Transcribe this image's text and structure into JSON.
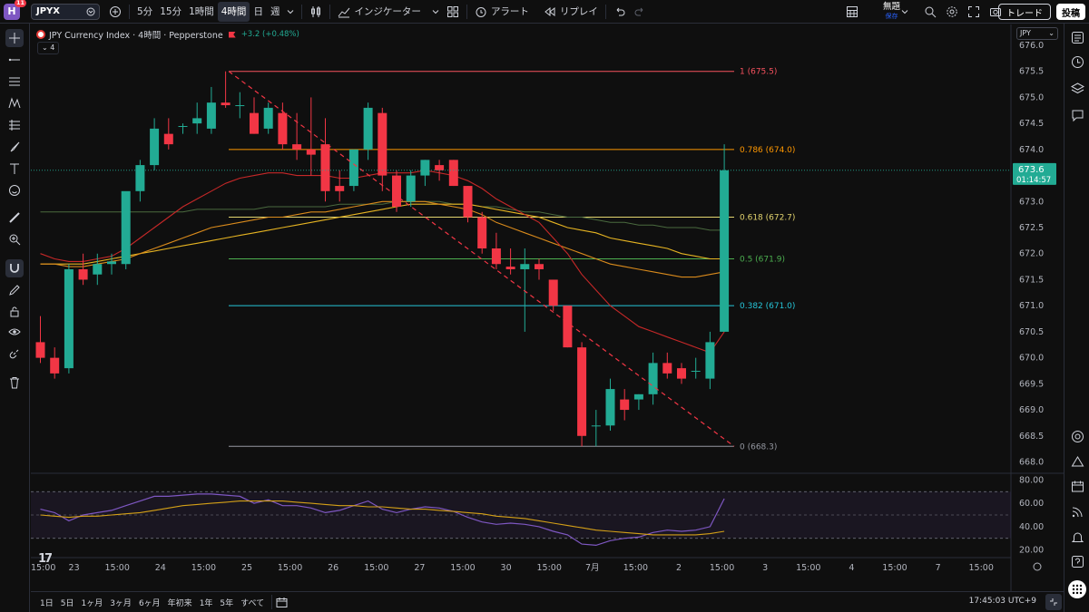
{
  "topbar": {
    "logo_letter": "H",
    "notification_count": "11",
    "symbol": "JPYX",
    "intervals": [
      "5分",
      "15分",
      "1時間",
      "4時間",
      "日",
      "週"
    ],
    "active_interval_index": 3,
    "indicators_label": "インジケーター",
    "alert_label": "アラート",
    "replay_label": "リプレイ",
    "layout_name": "無題",
    "layout_status": "保存",
    "trade_label": "トレード",
    "publish_label": "投稿"
  },
  "legend": {
    "title": "JPY Currency Index · 4時間 · Pepperstone",
    "change": "+3.2 (+0.48%)",
    "indicator_count": "4"
  },
  "currency_select": "JPY",
  "price_axis": {
    "labels": [
      "676.0",
      "675.5",
      "675.0",
      "674.5",
      "674.0",
      "673.0",
      "672.5",
      "672.0",
      "671.5",
      "671.0",
      "670.5",
      "670.0",
      "669.5",
      "669.0",
      "668.5",
      "668.0"
    ],
    "current_price": "673.6",
    "countdown": "01:14:57"
  },
  "rsi_axis": {
    "labels": [
      "80.00",
      "60.00",
      "40.00",
      "20.00"
    ]
  },
  "time_axis": {
    "labels": [
      "15:00",
      "23",
      "15:00",
      "24",
      "15:00",
      "25",
      "15:00",
      "26",
      "15:00",
      "27",
      "15:00",
      "30",
      "15:00",
      "7月",
      "15:00",
      "2",
      "15:00",
      "3",
      "15:00",
      "4",
      "15:00",
      "7",
      "15:00"
    ]
  },
  "fib_levels": [
    {
      "ratio": "1",
      "value": 675.5,
      "label": "1 (675.5)",
      "color": "#f7525f"
    },
    {
      "ratio": "0.786",
      "value": 674.0,
      "label": "0.786 (674.0)",
      "color": "#ff9800"
    },
    {
      "ratio": "0.618",
      "value": 672.7,
      "label": "0.618 (672.7)",
      "color": "#e4d56f"
    },
    {
      "ratio": "0.5",
      "value": 671.9,
      "label": "0.5 (671.9)",
      "color": "#4caf50"
    },
    {
      "ratio": "0.382",
      "value": 671.0,
      "label": "0.382 (671.0)",
      "color": "#26c6da"
    },
    {
      "ratio": "0",
      "value": 668.3,
      "label": "0 (668.3)",
      "color": "#9598a1"
    }
  ],
  "chart_data": {
    "type": "candlestick",
    "candles": [
      {
        "o": 670.3,
        "h": 670.8,
        "l": 669.9,
        "c": 670.0
      },
      {
        "o": 670.0,
        "h": 670.2,
        "l": 669.6,
        "c": 669.7
      },
      {
        "o": 669.8,
        "h": 671.8,
        "l": 669.7,
        "c": 671.7
      },
      {
        "o": 671.7,
        "h": 672.0,
        "l": 671.4,
        "c": 671.5
      },
      {
        "o": 671.6,
        "h": 672.0,
        "l": 671.4,
        "c": 671.8
      },
      {
        "o": 671.8,
        "h": 672.0,
        "l": 671.6,
        "c": 671.85
      },
      {
        "o": 671.8,
        "h": 673.0,
        "l": 671.7,
        "c": 673.2
      },
      {
        "o": 673.2,
        "h": 673.8,
        "l": 673.0,
        "c": 673.7
      },
      {
        "o": 673.7,
        "h": 674.6,
        "l": 673.6,
        "c": 674.4
      },
      {
        "o": 674.3,
        "h": 674.6,
        "l": 674.0,
        "c": 674.1
      },
      {
        "o": 674.45,
        "h": 674.5,
        "l": 674.3,
        "c": 674.45
      },
      {
        "o": 674.5,
        "h": 674.9,
        "l": 674.3,
        "c": 674.6
      },
      {
        "o": 674.4,
        "h": 675.2,
        "l": 674.3,
        "c": 674.9
      },
      {
        "o": 674.9,
        "h": 675.5,
        "l": 674.8,
        "c": 674.85
      },
      {
        "o": 674.85,
        "h": 675.1,
        "l": 674.6,
        "c": 674.85
      },
      {
        "o": 674.7,
        "h": 675.0,
        "l": 674.3,
        "c": 674.3
      },
      {
        "o": 674.4,
        "h": 674.9,
        "l": 674.3,
        "c": 674.8
      },
      {
        "o": 674.7,
        "h": 674.9,
        "l": 674.0,
        "c": 674.1
      },
      {
        "o": 674.1,
        "h": 674.7,
        "l": 673.8,
        "c": 674.0
      },
      {
        "o": 674.0,
        "h": 675.0,
        "l": 673.5,
        "c": 673.9
      },
      {
        "o": 674.1,
        "h": 674.6,
        "l": 673.0,
        "c": 673.2
      },
      {
        "o": 673.3,
        "h": 673.6,
        "l": 673.0,
        "c": 673.2
      },
      {
        "o": 673.3,
        "h": 674.0,
        "l": 673.2,
        "c": 674.0
      },
      {
        "o": 674.0,
        "h": 674.9,
        "l": 673.8,
        "c": 674.8
      },
      {
        "o": 674.7,
        "h": 674.8,
        "l": 673.2,
        "c": 673.5
      },
      {
        "o": 673.5,
        "h": 673.6,
        "l": 672.8,
        "c": 672.9
      },
      {
        "o": 673.0,
        "h": 673.6,
        "l": 672.9,
        "c": 673.5
      },
      {
        "o": 673.5,
        "h": 673.8,
        "l": 673.3,
        "c": 673.8
      },
      {
        "o": 673.7,
        "h": 673.8,
        "l": 673.4,
        "c": 673.6
      },
      {
        "o": 673.8,
        "h": 673.8,
        "l": 673.3,
        "c": 673.3
      },
      {
        "o": 673.3,
        "h": 673.3,
        "l": 672.6,
        "c": 672.7
      },
      {
        "o": 672.7,
        "h": 672.8,
        "l": 672.0,
        "c": 672.1
      },
      {
        "o": 672.1,
        "h": 672.4,
        "l": 671.7,
        "c": 671.8
      },
      {
        "o": 671.75,
        "h": 672.1,
        "l": 671.6,
        "c": 671.7
      },
      {
        "o": 671.7,
        "h": 672.1,
        "l": 670.5,
        "c": 671.8
      },
      {
        "o": 671.8,
        "h": 671.9,
        "l": 671.5,
        "c": 671.7
      },
      {
        "o": 671.5,
        "h": 671.5,
        "l": 670.9,
        "c": 671.0
      },
      {
        "o": 671.0,
        "h": 671.0,
        "l": 670.2,
        "c": 670.2
      },
      {
        "o": 670.2,
        "h": 670.3,
        "l": 668.3,
        "c": 668.5
      },
      {
        "o": 668.7,
        "h": 669.0,
        "l": 668.3,
        "c": 668.7
      },
      {
        "o": 668.7,
        "h": 669.6,
        "l": 668.6,
        "c": 669.4
      },
      {
        "o": 669.2,
        "h": 669.4,
        "l": 668.8,
        "c": 669.0
      },
      {
        "o": 669.2,
        "h": 669.3,
        "l": 669.0,
        "c": 669.3
      },
      {
        "o": 669.3,
        "h": 670.1,
        "l": 669.1,
        "c": 669.9
      },
      {
        "o": 669.9,
        "h": 670.1,
        "l": 669.6,
        "c": 669.7
      },
      {
        "o": 669.8,
        "h": 669.9,
        "l": 669.5,
        "c": 669.6
      },
      {
        "o": 669.75,
        "h": 670.0,
        "l": 669.6,
        "c": 669.75
      },
      {
        "o": 669.6,
        "h": 670.5,
        "l": 669.4,
        "c": 670.3
      },
      {
        "o": 670.5,
        "h": 674.1,
        "l": 670.5,
        "c": 673.6
      }
    ],
    "ma_red": [
      672.0,
      671.9,
      671.85,
      671.85,
      671.9,
      671.95,
      672.1,
      672.3,
      672.5,
      672.7,
      672.9,
      673.05,
      673.2,
      673.35,
      673.45,
      673.5,
      673.55,
      673.55,
      673.5,
      673.5,
      673.5,
      673.45,
      673.45,
      673.5,
      673.55,
      673.55,
      673.55,
      673.6,
      673.55,
      673.5,
      673.4,
      673.25,
      673.05,
      672.9,
      672.75,
      672.6,
      672.3,
      672.0,
      671.6,
      671.3,
      671.0,
      670.8,
      670.6,
      670.5,
      670.4,
      670.3,
      670.2,
      670.1,
      670.5
    ],
    "ma_orange": [
      671.8,
      671.8,
      671.75,
      671.75,
      671.8,
      671.85,
      671.9,
      672.0,
      672.1,
      672.2,
      672.3,
      672.4,
      672.5,
      672.55,
      672.6,
      672.65,
      672.7,
      672.7,
      672.75,
      672.8,
      672.8,
      672.85,
      672.9,
      672.95,
      673.0,
      673.0,
      673.0,
      673.0,
      672.95,
      672.9,
      672.85,
      672.75,
      672.6,
      672.5,
      672.4,
      672.3,
      672.2,
      672.1,
      672.0,
      671.9,
      671.8,
      671.75,
      671.7,
      671.65,
      671.6,
      671.55,
      671.55,
      671.6,
      671.65
    ],
    "ma_yellow": [
      671.8,
      671.8,
      671.8,
      671.8,
      671.85,
      671.9,
      671.95,
      672.0,
      672.05,
      672.1,
      672.15,
      672.2,
      672.25,
      672.3,
      672.35,
      672.4,
      672.45,
      672.5,
      672.55,
      672.6,
      672.65,
      672.7,
      672.75,
      672.8,
      672.85,
      672.9,
      672.95,
      672.95,
      672.95,
      672.95,
      672.95,
      672.9,
      672.85,
      672.8,
      672.75,
      672.7,
      672.6,
      672.5,
      672.45,
      672.4,
      672.3,
      672.25,
      672.2,
      672.15,
      672.1,
      672.0,
      671.95,
      671.9,
      671.9
    ],
    "ma_green": [
      672.8,
      672.8,
      672.8,
      672.8,
      672.8,
      672.8,
      672.8,
      672.8,
      672.8,
      672.8,
      672.8,
      672.85,
      672.85,
      672.85,
      672.85,
      672.85,
      672.9,
      672.9,
      672.9,
      672.9,
      672.9,
      672.95,
      672.95,
      672.95,
      672.95,
      673.0,
      673.0,
      673.0,
      673.0,
      672.95,
      672.95,
      672.9,
      672.9,
      672.85,
      672.8,
      672.8,
      672.75,
      672.7,
      672.7,
      672.65,
      672.6,
      672.6,
      672.55,
      672.55,
      672.5,
      672.5,
      672.5,
      672.45,
      672.45
    ],
    "rsi": [
      55,
      52,
      45,
      50,
      52,
      54,
      58,
      62,
      66,
      66,
      67,
      68,
      68,
      67,
      66,
      60,
      63,
      58,
      58,
      56,
      52,
      54,
      58,
      62,
      55,
      52,
      55,
      57,
      56,
      53,
      48,
      44,
      42,
      43,
      42,
      40,
      36,
      33,
      25,
      24,
      28,
      30,
      31,
      35,
      37,
      36,
      37,
      40,
      64
    ],
    "rsi_ma": [
      50,
      49,
      48,
      49,
      49,
      50,
      51,
      52,
      54,
      56,
      58,
      59,
      60,
      61,
      62,
      62,
      62,
      62,
      61,
      60,
      59,
      58,
      58,
      57,
      57,
      56,
      55,
      55,
      54,
      53,
      52,
      51,
      49,
      48,
      47,
      45,
      43,
      41,
      39,
      37,
      36,
      35,
      34,
      33,
      33,
      33,
      33,
      34,
      36
    ],
    "price_range": [
      667.8,
      676.4
    ],
    "rsi_range": [
      15,
      85
    ],
    "rsi_bands": [
      70,
      50,
      30
    ]
  },
  "bottombar": {
    "ranges": [
      "1日",
      "5日",
      "1ヶ月",
      "3ヶ月",
      "6ヶ月",
      "年初来",
      "1年",
      "5年",
      "すべて"
    ],
    "clock": "17:45:03 UTC+9"
  },
  "tv_logo": "17",
  "colors": {
    "up": "#22ab94",
    "down": "#f23645",
    "accent": "#2962ff"
  }
}
